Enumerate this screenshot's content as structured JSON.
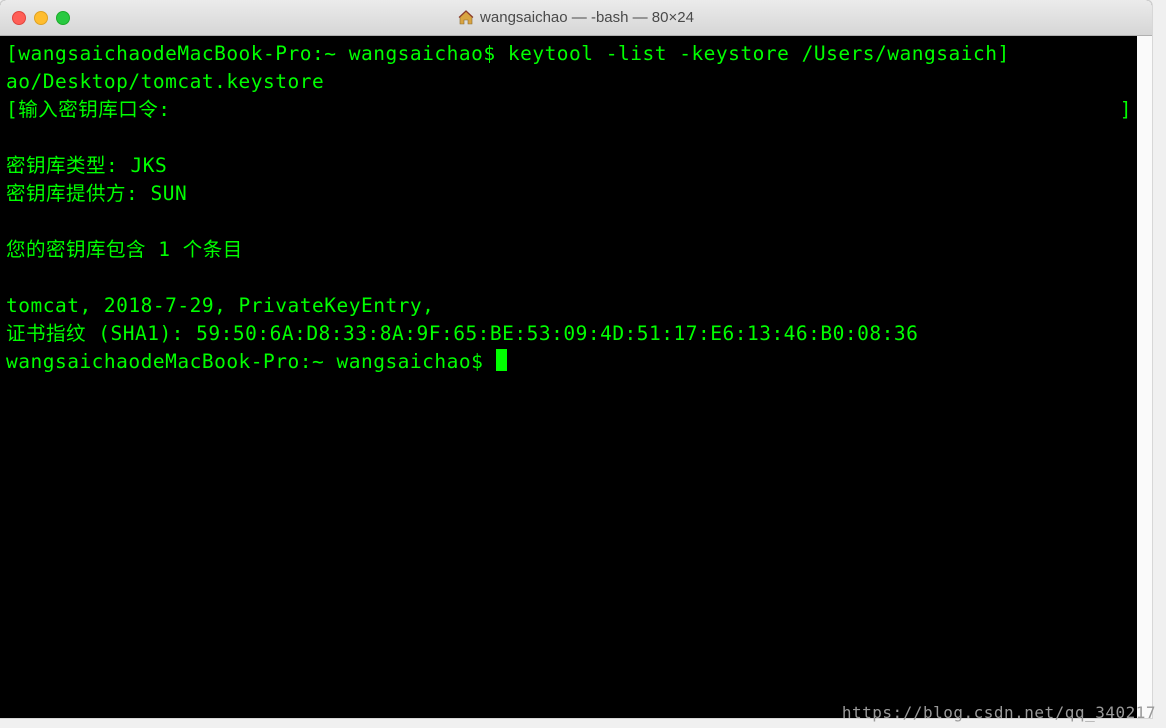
{
  "window": {
    "title": "wangsaichao — -bash — 80×24"
  },
  "terminal": {
    "line1_prompt": "[wangsaichaodeMacBook-Pro:~ wangsaichao$ ",
    "line1_cmd": "keytool -list -keystore /Users/wangsaich]",
    "line2": "ao/Desktop/tomcat.keystore",
    "line3_left": "[输入密钥库口令:",
    "line3_right": "]",
    "line4": "",
    "line5": "密钥库类型: JKS",
    "line6": "密钥库提供方: SUN",
    "line7": "",
    "line8": "您的密钥库包含 1 个条目",
    "line9": "",
    "line10": "tomcat, 2018-7-29, PrivateKeyEntry,",
    "line11": "证书指纹 (SHA1): 59:50:6A:D8:33:8A:9F:65:BE:53:09:4D:51:17:E6:13:46:B0:08:36",
    "line12_prompt": "wangsaichaodeMacBook-Pro:~ wangsaichao$ "
  },
  "watermark": "https://blog.csdn.net/qq_340217"
}
